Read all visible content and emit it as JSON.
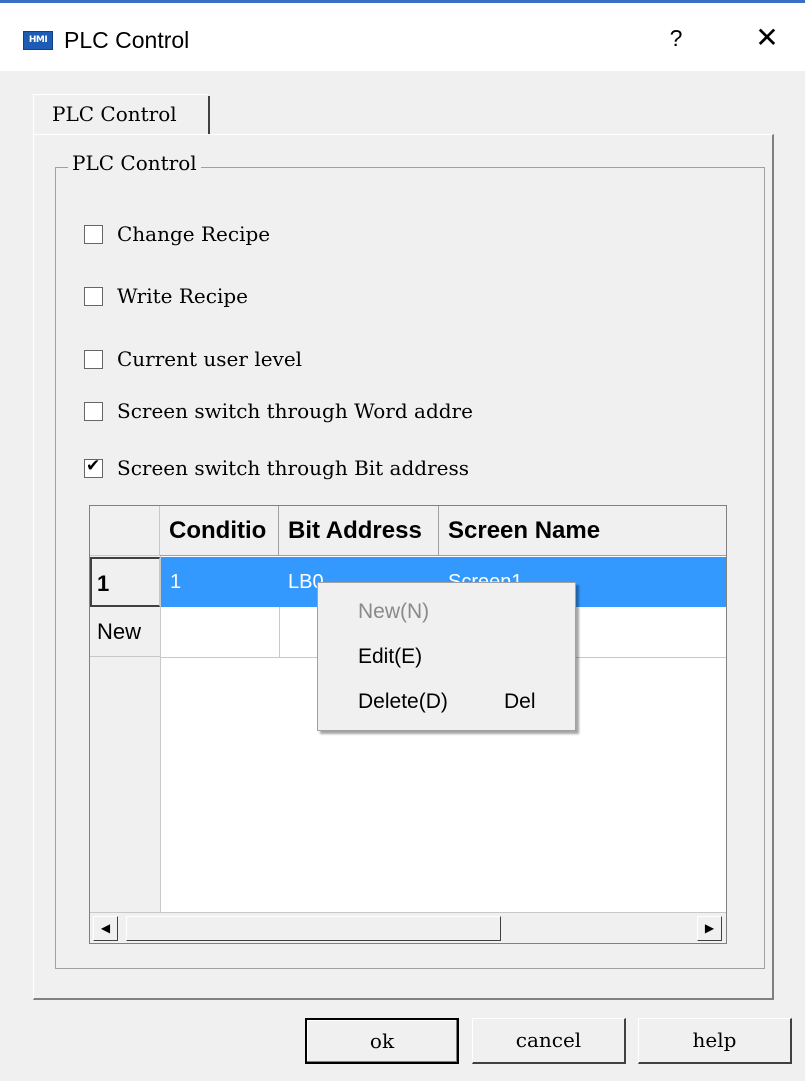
{
  "window": {
    "title": "PLC Control",
    "app_icon_text": "HMI",
    "help_glyph": "?",
    "close_glyph": "✕"
  },
  "tabs": [
    {
      "label": "PLC Control",
      "selected": true
    }
  ],
  "group": {
    "label": "PLC Control"
  },
  "checkboxes": [
    {
      "label": "Change Recipe",
      "checked": false
    },
    {
      "label": "Write Recipe",
      "checked": false
    },
    {
      "label": "Current user level",
      "checked": false
    },
    {
      "label": "Screen switch through Word addre",
      "checked": false
    },
    {
      "label": "Screen switch through Bit address",
      "checked": true
    }
  ],
  "grid": {
    "columns": [
      "Conditio",
      "Bit Address",
      "Screen Name"
    ],
    "rows": [
      {
        "header": "1",
        "cells": [
          "1",
          "LB0",
          "Screen1"
        ],
        "selected": true
      }
    ],
    "new_row_header": "New",
    "scroll_left_glyph": "◀",
    "scroll_right_glyph": "▶"
  },
  "context_menu": {
    "items": [
      {
        "label": "New(N)",
        "shortcut": "",
        "enabled": false
      },
      {
        "label": "Edit(E)",
        "shortcut": "",
        "enabled": true
      },
      {
        "label": "Delete(D)",
        "shortcut": "Del",
        "enabled": true
      }
    ]
  },
  "buttons": {
    "ok": "ok",
    "cancel": "cancel",
    "help": "help"
  },
  "colors": {
    "selection": "#3399ff",
    "title_accent": "#3b6fc4"
  }
}
